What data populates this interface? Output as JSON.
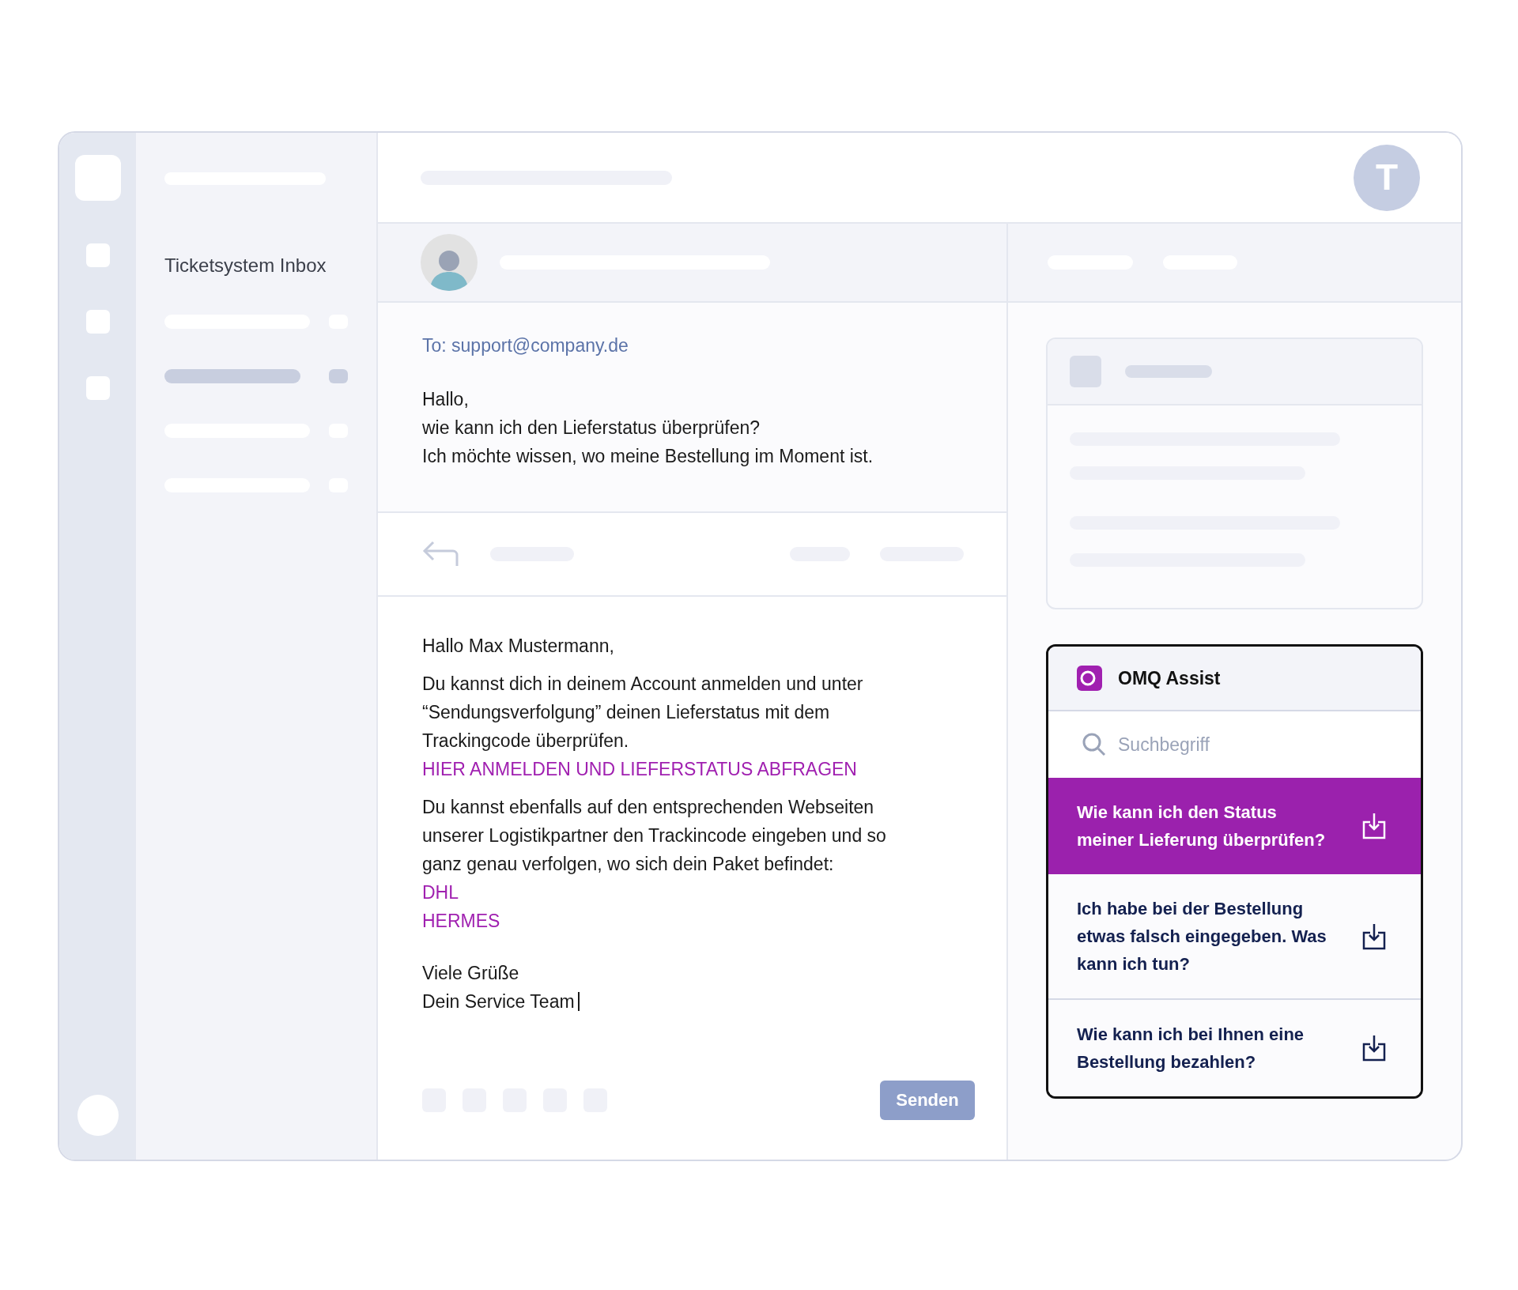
{
  "sidebar": {
    "title": "Ticketsystem Inbox",
    "items": [
      {
        "selected": false
      },
      {
        "selected": true
      },
      {
        "selected": false
      },
      {
        "selected": false
      }
    ]
  },
  "user_avatar": {
    "initial": "T"
  },
  "message": {
    "to": "To: support@company.de",
    "lines": [
      "Hallo,",
      "wie kann ich den Lieferstatus überprüfen?",
      "Ich möchte wissen, wo meine Bestellung im Moment ist."
    ]
  },
  "reply": {
    "paragraphs": [
      {
        "lines": [
          {
            "kind": "text",
            "text": "Hallo Max Mustermann,"
          }
        ]
      },
      {
        "lines": [
          {
            "kind": "text",
            "text": "Du kannst dich in deinem Account anmelden und unter"
          },
          {
            "kind": "text",
            "text": "“Sendungsverfolgung” deinen Lieferstatus mit dem"
          },
          {
            "kind": "text",
            "text": "Trackingcode überprüfen."
          },
          {
            "kind": "link",
            "text": "HIER ANMELDEN UND LIEFERSTATUS ABFRAGEN"
          }
        ]
      },
      {
        "lines": [
          {
            "kind": "text",
            "text": "Du kannst ebenfalls auf den entsprechenden Webseiten"
          },
          {
            "kind": "text",
            "text": "unserer Logistikpartner den Trackincode eingeben und so"
          },
          {
            "kind": "text",
            "text": "ganz genau verfolgen, wo sich dein Paket befindet:"
          },
          {
            "kind": "link",
            "text": "DHL"
          },
          {
            "kind": "link",
            "text": "HERMES"
          }
        ]
      },
      {
        "lines": [
          {
            "kind": "text",
            "text": "Viele Grüße"
          },
          {
            "kind": "text",
            "text": "Dein Service Team"
          }
        ]
      }
    ],
    "send_button": "Senden"
  },
  "assist": {
    "title": "OMQ Assist",
    "search": {
      "placeholder": "Suchbegriff"
    },
    "suggestions": [
      {
        "text": "Wie kann ich den Status meiner Lieferung überprüfen?",
        "selected": true
      },
      {
        "text": "Ich habe bei der Bestellung etwas falsch eingegeben. Was kann ich tun?",
        "selected": false
      },
      {
        "text": "Wie kann ich bei Ihnen eine Bestellung bezahlen?",
        "selected": false
      }
    ]
  }
}
